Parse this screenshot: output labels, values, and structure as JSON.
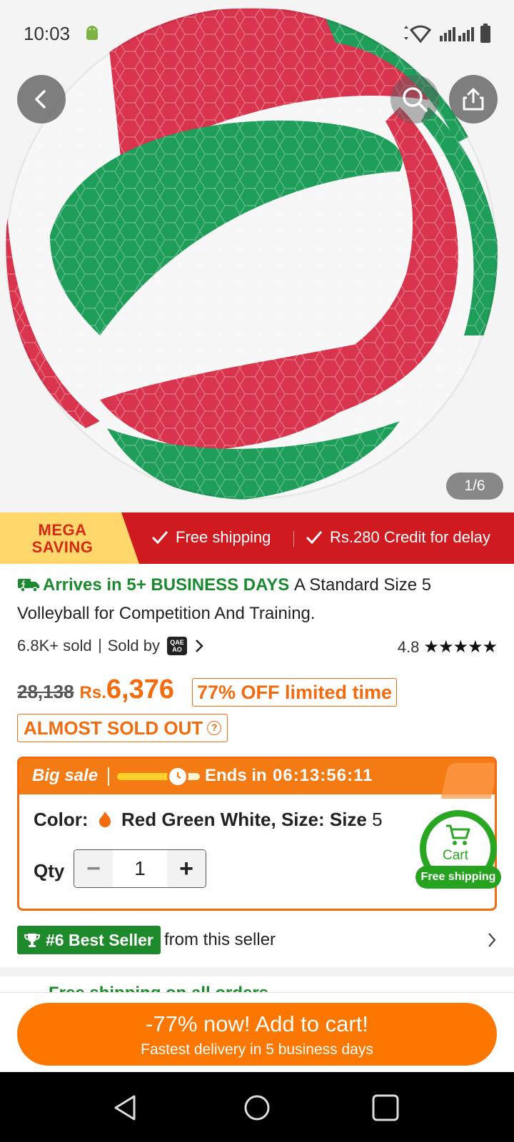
{
  "status_bar": {
    "time": "10:03"
  },
  "gallery": {
    "counter": "1/6"
  },
  "promo": {
    "mega_line1": "MEGA",
    "mega_line2": "SAVING",
    "item1": "Free shipping",
    "item2": "Rs.280 Credit for delay"
  },
  "product": {
    "arrives": "Arrives in 5+ BUSINESS DAYS",
    "title": "A Standard Size 5 Volleyball for Competition And Training.",
    "sold_count": "6.8K+ sold",
    "sold_by_label": "Sold by",
    "seller_logo_text": "QAE AO",
    "rating": "4.8",
    "rating_stars": 4.8,
    "stars_glyph": "★★★★★",
    "old_price": "28,138",
    "currency": "Rs.",
    "price": "6,376",
    "discount_badge": "77% OFF limited time",
    "stock_badge": "ALMOST SOLD OUT"
  },
  "sale": {
    "label": "Big sale",
    "progress": 0.8,
    "ends_label": "Ends in",
    "countdown": "06:13:56:11",
    "color_label": "Color:",
    "color_value": "Red Green White,",
    "size_label": "Size: Size",
    "size_value": "5",
    "qty_label": "Qty",
    "qty_value": "1",
    "minus": "−",
    "plus": "+"
  },
  "cart": {
    "label": "Cart",
    "pill": "Free shipping"
  },
  "best_seller": {
    "badge": "#6 Best Seller",
    "suffix": "from this seller"
  },
  "peek_row": "Free shipping on all orders",
  "cta": {
    "main": "-77% now! Add to cart!",
    "sub": "Fastest delivery in 5 business days"
  },
  "colors": {
    "accent_orange": "#fb7701",
    "promo_red": "#cf1a1f",
    "success_green": "#1d8a2b",
    "ball_green": "#1f9e5a",
    "ball_red": "#d8344e"
  },
  "icons": [
    "android-icon",
    "wifi-icon",
    "signal-icon",
    "battery-icon",
    "back-arrow-icon",
    "search-icon",
    "share-icon",
    "check-icon",
    "truck-icon",
    "chevron-right-icon",
    "star-icon",
    "question-icon",
    "clock-icon",
    "flame-icon",
    "cart-icon",
    "trophy-icon",
    "nav-back-icon",
    "nav-home-icon",
    "nav-recents-icon"
  ]
}
